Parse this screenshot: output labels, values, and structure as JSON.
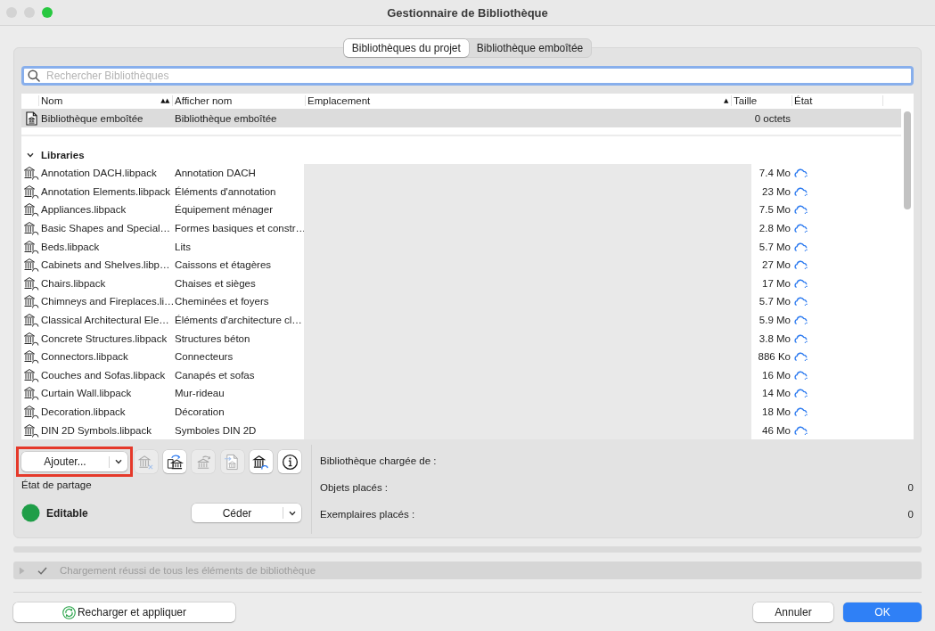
{
  "window": {
    "title": "Gestionnaire de Bibliothèque",
    "controls": [
      {
        "kind": "close",
        "disabled": true
      },
      {
        "kind": "minimize",
        "disabled": true
      },
      {
        "kind": "zoom",
        "disabled": false
      }
    ]
  },
  "tabs": [
    {
      "label": "Bibliothèques du projet",
      "selected": true
    },
    {
      "label": "Bibliothèque emboîtée",
      "selected": false
    }
  ],
  "search": {
    "placeholder": "Rechercher Bibliothèques"
  },
  "table": {
    "columns": [
      {
        "label": "Nom",
        "sort_indicator": "▲▲"
      },
      {
        "label": "Afficher nom"
      },
      {
        "label": "Emplacement",
        "sort_indicator": "▲"
      },
      {
        "label": "Taille"
      },
      {
        "label": "État"
      }
    ],
    "location_hidden": true,
    "nested_library": {
      "name": "Bibliothèque emboîtée",
      "display_name": "Bibliothèque emboîtée",
      "size": "0 octets",
      "selected": true
    },
    "groups": [
      {
        "label": "Libraries",
        "expanded": true,
        "rows": [
          {
            "name": "Annotation DACH.libpack",
            "display_name": "Annotation DACH",
            "size": "7.4 Mo",
            "selected": false
          },
          {
            "name": "Annotation Elements.libpack",
            "display_name": "Éléments d'annotation",
            "size": "23 Mo",
            "selected": false
          },
          {
            "name": "Appliances.libpack",
            "display_name": "Équipement ménager",
            "size": "7.5 Mo",
            "selected": false
          },
          {
            "name": "Basic Shapes and Special…",
            "display_name": "Formes basiques et constr…",
            "size": "2.8 Mo",
            "selected": false
          },
          {
            "name": "Beds.libpack",
            "display_name": "Lits",
            "size": "5.7 Mo",
            "selected": false
          },
          {
            "name": "Cabinets and Shelves.libp…",
            "display_name": "Caissons et étagères",
            "size": "27 Mo",
            "selected": false
          },
          {
            "name": "Chairs.libpack",
            "display_name": "Chaises et sièges",
            "size": "17 Mo",
            "selected": false
          },
          {
            "name": "Chimneys and Fireplaces.li…",
            "display_name": "Cheminées et foyers",
            "size": "5.7 Mo",
            "selected": false
          },
          {
            "name": "Classical Architectural Ele…",
            "display_name": "Éléments d'architecture cl…",
            "size": "5.9 Mo",
            "selected": false
          },
          {
            "name": "Concrete Structures.libpack",
            "display_name": "Structures béton",
            "size": "3.8 Mo",
            "selected": false
          },
          {
            "name": "Connectors.libpack",
            "display_name": "Connecteurs",
            "size": "886 Ko",
            "selected": false
          },
          {
            "name": "Couches and Sofas.libpack",
            "display_name": "Canapés et sofas",
            "size": "16 Mo",
            "selected": false
          },
          {
            "name": "Curtain Wall.libpack",
            "display_name": "Mur-rideau",
            "size": "14 Mo",
            "selected": false
          },
          {
            "name": "Decoration.libpack",
            "display_name": "Décoration",
            "size": "18 Mo",
            "selected": false
          },
          {
            "name": "DIN 2D Symbols.libpack",
            "display_name": "Symboles DIN 2D",
            "size": "46 Mo",
            "selected": false
          }
        ]
      }
    ]
  },
  "toolbar": {
    "add_button": {
      "label": "Ajouter...",
      "highlighted": true
    },
    "tool_buttons": [
      {
        "kind": "remove",
        "disabled": true
      },
      {
        "kind": "swap",
        "disabled": false
      },
      {
        "kind": "refresh",
        "disabled": true
      },
      {
        "kind": "import",
        "disabled": true
      },
      {
        "kind": "cloud",
        "disabled": false
      },
      {
        "kind": "info",
        "disabled": false
      }
    ]
  },
  "sharing": {
    "label": "État de partage",
    "status": "Editable",
    "color": "#1f9e48",
    "button": "Céder"
  },
  "details": [
    {
      "label": "Bibliothèque chargée de :"
    },
    {
      "label": "Objets placés :",
      "value": "0"
    },
    {
      "label": "Exemplaires placés :",
      "value": "0"
    }
  ],
  "status_bar": {
    "expanded": false,
    "text": "Chargement réussi de tous les éléments de bibliothèque"
  },
  "buttons": [
    {
      "kind": "reload",
      "label": "Recharger et appliquer",
      "default": false
    },
    {
      "kind": "cancel",
      "label": "Annuler",
      "default": false
    },
    {
      "kind": "ok",
      "label": "OK",
      "default": true
    }
  ]
}
